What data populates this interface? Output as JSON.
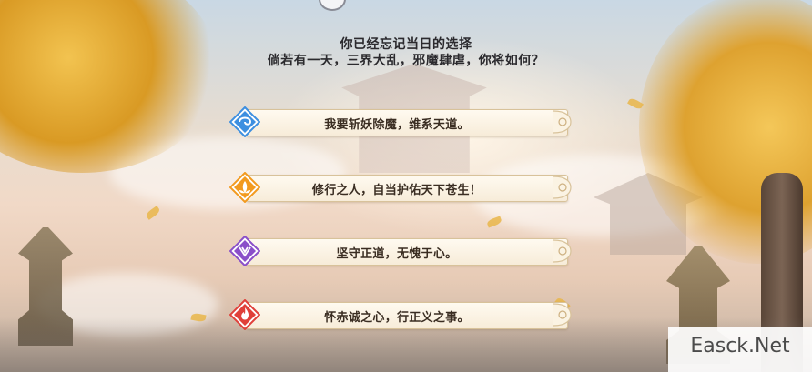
{
  "dialog": {
    "prompt_line1": "你已经忘记当日的选择",
    "prompt_line2": "倘若有一天，三界大乱，邪魔肆虐，你将如何？"
  },
  "options": [
    {
      "label": "我要斩妖除魔，维系天道。",
      "emblem": "blue-swirl-emblem-icon",
      "color": "#3d8fe0"
    },
    {
      "label": "修行之人，自当护佑天下苍生！",
      "emblem": "orange-lotus-emblem-icon",
      "color": "#f29a1f"
    },
    {
      "label": "坚守正道，无愧于心。",
      "emblem": "purple-sigil-emblem-icon",
      "color": "#8a4fc9"
    },
    {
      "label": "怀赤诚之心，行正义之事。",
      "emblem": "red-flame-emblem-icon",
      "color": "#e0403a"
    }
  ],
  "watermark": {
    "text": "Easck.Net"
  }
}
